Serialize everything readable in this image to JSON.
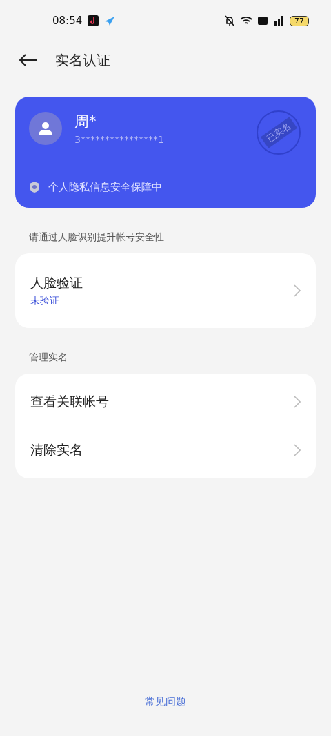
{
  "status_bar": {
    "time": "08:54",
    "battery": "77"
  },
  "header": {
    "title": "实名认证"
  },
  "identity_card": {
    "name": "周*",
    "id_number": "3****************1",
    "stamp": "已实名",
    "privacy_note": "个人隐私信息安全保障中"
  },
  "sections": [
    {
      "heading": "请通过人脸识别提升帐号安全性",
      "items": [
        {
          "label": "人脸验证",
          "status": "未验证"
        }
      ]
    },
    {
      "heading": "管理实名",
      "items": [
        {
          "label": "查看关联帐号"
        },
        {
          "label": "清除实名"
        }
      ]
    }
  ],
  "footer_link": "常见问题"
}
